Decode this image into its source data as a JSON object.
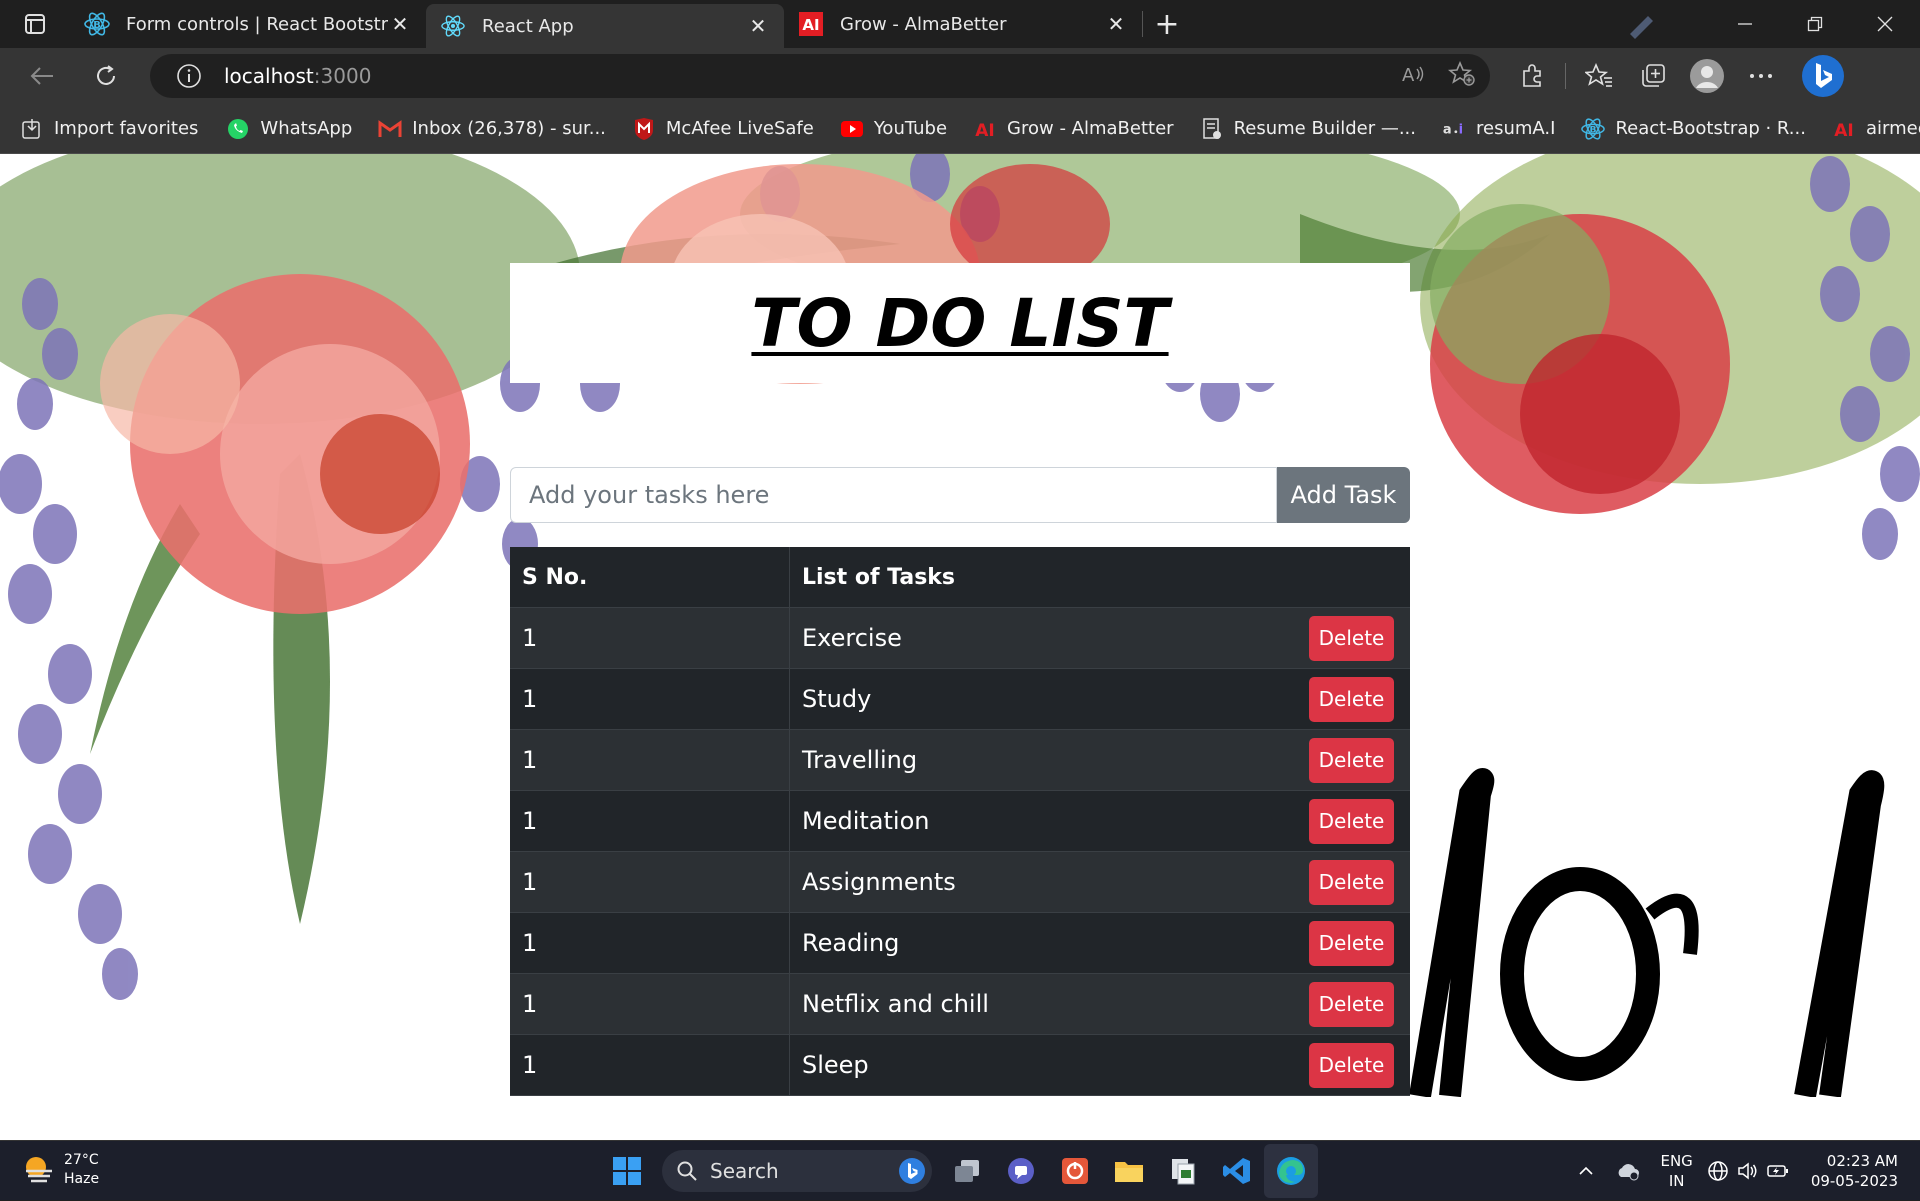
{
  "browser": {
    "tabs": [
      {
        "title": "Form controls | React Bootstrap",
        "icon": "react-bootstrap-icon",
        "active": false
      },
      {
        "title": "React App",
        "icon": "react-icon",
        "active": true
      },
      {
        "title": "Grow - AlmaBetter",
        "icon": "almabetter-icon",
        "active": false
      }
    ],
    "url_host": "localhost",
    "url_port": ":3000",
    "bookmarks": [
      {
        "label": "Import favorites",
        "icon": "import-icon"
      },
      {
        "label": "WhatsApp",
        "icon": "whatsapp-icon"
      },
      {
        "label": "Inbox (26,378) - sur...",
        "icon": "gmail-icon"
      },
      {
        "label": "McAfee LiveSafe",
        "icon": "mcafee-icon"
      },
      {
        "label": "YouTube",
        "icon": "youtube-icon"
      },
      {
        "label": "Grow - AlmaBetter",
        "icon": "almabetter-icon"
      },
      {
        "label": "Resume Builder —...",
        "icon": "resume-icon"
      },
      {
        "label": "resumA.I",
        "icon": "resumai-icon"
      },
      {
        "label": "React-Bootstrap · R...",
        "icon": "react-bootstrap-icon"
      },
      {
        "label": "airmeet",
        "icon": "airmeet-icon"
      }
    ]
  },
  "app": {
    "title": "TO DO LIST",
    "input_placeholder": "Add your tasks here",
    "add_button": "Add Task",
    "table_headers": {
      "sno": "S No.",
      "tasks": "List of Tasks"
    },
    "delete_label": "Delete",
    "tasks": [
      {
        "sno": "1",
        "name": "Exercise"
      },
      {
        "sno": "1",
        "name": "Study"
      },
      {
        "sno": "1",
        "name": "Travelling"
      },
      {
        "sno": "1",
        "name": "Meditation"
      },
      {
        "sno": "1",
        "name": "Assignments"
      },
      {
        "sno": "1",
        "name": "Reading"
      },
      {
        "sno": "1",
        "name": "Netflix and chill"
      },
      {
        "sno": "1",
        "name": "Sleep"
      }
    ],
    "colors": {
      "delete": "#dc3545",
      "add": "#6c757d",
      "table": "#212529"
    }
  },
  "taskbar": {
    "temperature": "27°C",
    "weather": "Haze",
    "search_label": "Search",
    "language": "ENG",
    "region": "IN",
    "time": "02:23 AM",
    "date": "09-05-2023"
  }
}
